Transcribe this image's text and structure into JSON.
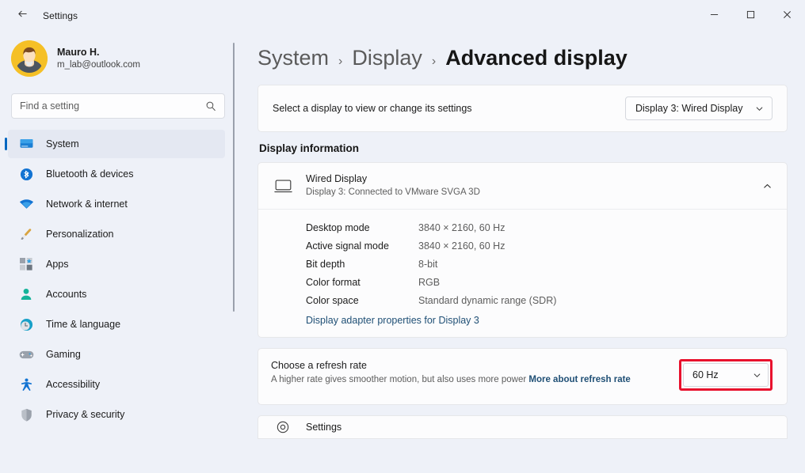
{
  "window": {
    "app_title": "Settings",
    "back_icon": "back-arrow-icon",
    "controls": {
      "minimize": "minimize-icon",
      "maximize": "maximize-icon",
      "close": "close-icon"
    }
  },
  "sidebar": {
    "profile": {
      "name": "Mauro H.",
      "email": "m_lab@outlook.com",
      "avatar": "user-avatar"
    },
    "search": {
      "placeholder": "Find a setting",
      "value": "",
      "icon": "search-icon"
    },
    "items": [
      {
        "label": "System",
        "icon": "monitor-icon",
        "active": true
      },
      {
        "label": "Bluetooth & devices",
        "icon": "bluetooth-icon",
        "active": false
      },
      {
        "label": "Network & internet",
        "icon": "wifi-icon",
        "active": false
      },
      {
        "label": "Personalization",
        "icon": "brush-icon",
        "active": false
      },
      {
        "label": "Apps",
        "icon": "apps-icon",
        "active": false
      },
      {
        "label": "Accounts",
        "icon": "account-icon",
        "active": false
      },
      {
        "label": "Time & language",
        "icon": "clock-icon",
        "active": false
      },
      {
        "label": "Gaming",
        "icon": "gamepad-icon",
        "active": false
      },
      {
        "label": "Accessibility",
        "icon": "accessibility-icon",
        "active": false
      },
      {
        "label": "Privacy & security",
        "icon": "shield-icon",
        "active": false
      }
    ]
  },
  "breadcrumb": {
    "root": "System",
    "parent": "Display",
    "current": "Advanced display",
    "separator": "›"
  },
  "display_selector": {
    "label": "Select a display to view or change its settings",
    "selected": "Display 3: Wired Display",
    "chevron": "chevron-down-icon"
  },
  "display_information": {
    "section_title": "Display information",
    "device": {
      "name": "Wired Display",
      "subtitle": "Display 3: Connected to VMware SVGA 3D",
      "icon": "monitor-outline-icon",
      "expand_icon": "chevron-up-icon"
    },
    "details": [
      {
        "key": "Desktop mode",
        "value": "3840 × 2160, 60 Hz"
      },
      {
        "key": "Active signal mode",
        "value": "3840 × 2160, 60 Hz"
      },
      {
        "key": "Bit depth",
        "value": "8-bit"
      },
      {
        "key": "Color format",
        "value": "RGB"
      },
      {
        "key": "Color space",
        "value": "Standard dynamic range (SDR)"
      }
    ],
    "adapter_link": "Display adapter properties for Display 3"
  },
  "refresh_rate": {
    "title": "Choose a refresh rate",
    "description": "A higher rate gives smoother motion, but also uses more power",
    "link_text": "More about refresh rate",
    "selected": "60 Hz",
    "chevron": "chevron-down-icon",
    "highlight_color": "#e8112d"
  },
  "partial_card": {
    "text": "Settings"
  },
  "colors": {
    "accent": "#0067c0",
    "window_bg": "#eef1f8",
    "card_bg": "#fcfcfd",
    "link": "#1f4f75"
  }
}
